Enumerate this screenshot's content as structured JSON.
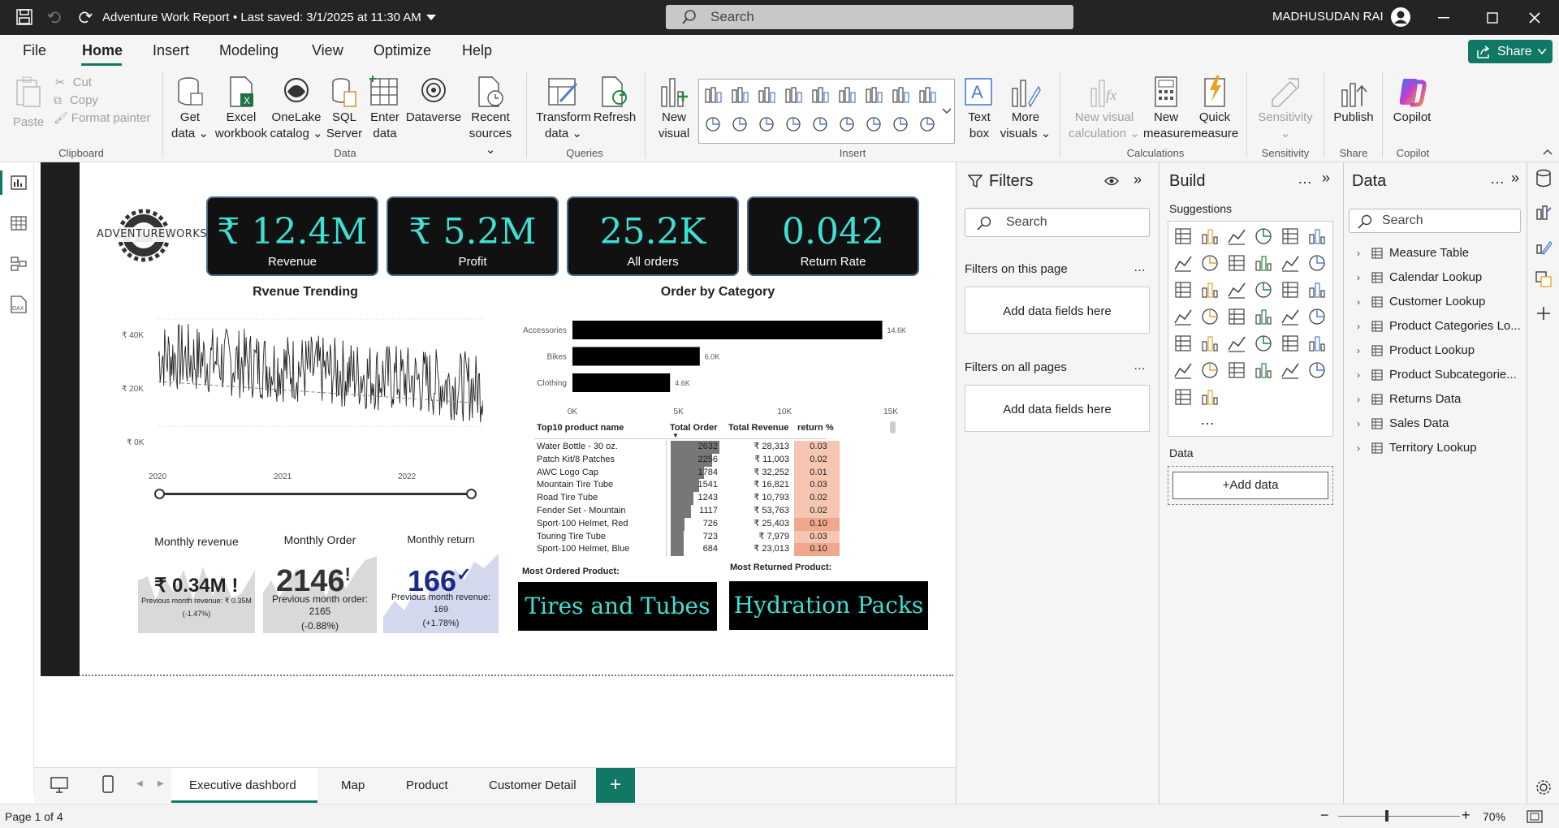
{
  "window": {
    "title": "Adventure Work Report",
    "saved": "• Last saved: 3/1/2025 at 11:30 AM",
    "search_placeholder": "Search",
    "user": "MADHUSUDAN RAI"
  },
  "menu": {
    "tabs": [
      "File",
      "Home",
      "Insert",
      "Modeling",
      "View",
      "Optimize",
      "Help"
    ],
    "active": "Home",
    "share": "Share"
  },
  "ribbon": {
    "clipboard": {
      "paste": "Paste",
      "cut": "Cut",
      "copy": "Copy",
      "format_painter": "Format painter",
      "group": "Clipboard"
    },
    "data": {
      "get_data": "Get",
      "get_data2": "data",
      "excel": "Excel",
      "excel2": "workbook",
      "onelake": "OneLake",
      "onelake2": "catalog",
      "sql": "SQL",
      "sql2": "Server",
      "enter": "Enter",
      "enter2": "data",
      "dataverse": "Dataverse",
      "recent": "Recent",
      "recent2": "sources",
      "group": "Data"
    },
    "queries": {
      "transform": "Transform",
      "transform2": "data",
      "refresh": "Refresh",
      "group": "Queries"
    },
    "insert": {
      "new_visual": "New",
      "new_visual2": "visual",
      "text_box": "Text",
      "text_box2": "box",
      "more_visuals": "More",
      "more_visuals2": "visuals",
      "group": "Insert"
    },
    "calculations": {
      "nvc": "New visual",
      "nvc2": "calculation",
      "new_measure": "New",
      "new_measure2": "measure",
      "quick_measure": "Quick",
      "quick_measure2": "measure",
      "group": "Calculations"
    },
    "sensitivity": {
      "label": "Sensitivity",
      "group": "Sensitivity"
    },
    "share": {
      "publish": "Publish",
      "group": "Share"
    },
    "copilot": {
      "label": "Copilot",
      "group": "Copilot"
    }
  },
  "kpis": [
    {
      "value": "₹ 12.4M",
      "label": "Revenue"
    },
    {
      "value": "₹ 5.2M",
      "label": "Profit"
    },
    {
      "value": "25.2K",
      "label": "All orders"
    },
    {
      "value": "0.042",
      "label": "Return Rate"
    }
  ],
  "logo": {
    "text": "ADVENTUREWORKS"
  },
  "trend": {
    "title": "Rvenue Trending",
    "yticks": [
      "₹ 40K",
      "₹ 20K",
      "₹ 0K"
    ],
    "xticks": [
      "2020",
      "2021",
      "2022"
    ]
  },
  "category": {
    "title": "Order by Category",
    "xticks": [
      "0K",
      "5K",
      "10K",
      "15K"
    ]
  },
  "chart_data": [
    {
      "type": "bar",
      "title": "Order by Category",
      "categories": [
        "Accessories",
        "Bikes",
        "Clothing"
      ],
      "values": [
        14.6,
        6.0,
        4.6
      ],
      "value_labels": [
        "14.6K",
        "6.0K",
        "4.6K"
      ],
      "xlim": [
        0,
        15
      ],
      "xlabel": "",
      "ylabel": ""
    },
    {
      "type": "line",
      "title": "Rvenue Trending",
      "x_range": [
        "2020",
        "2022"
      ],
      "ylim": [
        0,
        45000
      ],
      "approx_level": [
        28000,
        22000,
        15000
      ],
      "xlabel": "",
      "ylabel": ""
    }
  ],
  "table": {
    "headers": [
      "Top10 product name",
      "Total Order",
      "Total Revenue",
      "return %"
    ],
    "rows": [
      [
        "Water Bottle - 30 oz.",
        "2632",
        "₹ 28,313",
        "0.03"
      ],
      [
        "Patch Kit/8 Patches",
        "2256",
        "₹ 11,003",
        "0.02"
      ],
      [
        "AWC Logo Cap",
        "1784",
        "₹ 32,252",
        "0.01"
      ],
      [
        "Mountain Tire Tube",
        "1541",
        "₹ 16,821",
        "0.03"
      ],
      [
        "Road Tire Tube",
        "1243",
        "₹ 10,793",
        "0.02"
      ],
      [
        "Fender Set - Mountain",
        "1117",
        "₹ 53,763",
        "0.02"
      ],
      [
        "Sport-100 Helmet, Red",
        "726",
        "₹ 25,403",
        "0.10"
      ],
      [
        "Touring Tire Tube",
        "723",
        "₹ 7,979",
        "0.03"
      ],
      [
        "Sport-100 Helmet, Blue",
        "684",
        "₹ 23,013",
        "0.10"
      ]
    ]
  },
  "monthly": {
    "revenue": {
      "title": "Monthly revenue",
      "value": "₹ 0.34M",
      "mark": "!",
      "prev": "Previous month revenue: ₹ 0.35M",
      "change": "(-1.47%)"
    },
    "order": {
      "title": "Monthly Order",
      "value": "2146",
      "mark": "!",
      "prev": "Previous month order:",
      "prev2": "2165",
      "change": "(-0.88%)"
    },
    "return": {
      "title": "Monthly return",
      "value": "166",
      "mark": "✓",
      "prev": "Previous month revenue:",
      "prev2": "169",
      "change": "(+1.78%)"
    }
  },
  "most": {
    "ordered_label": "Most Ordered Product:",
    "ordered": "Tires and Tubes",
    "returned_label": "Most Returned Product:",
    "returned": "Hydration Packs"
  },
  "pages": {
    "tabs": [
      "Executive dashbord",
      "Map",
      "Product",
      "Customer Detail"
    ],
    "active": "Executive dashbord",
    "add": "+"
  },
  "status": {
    "page": "Page 1 of 4",
    "zoom": "70%"
  },
  "filters": {
    "title": "Filters",
    "search": "Search",
    "on_page": "Filters on this page",
    "on_all": "Filters on all pages",
    "add": "Add data fields here"
  },
  "build": {
    "title": "Build",
    "suggestions": "Suggestions",
    "data": "Data",
    "add_data": "+Add data"
  },
  "datapane": {
    "title": "Data",
    "search": "Search",
    "items": [
      "Measure Table",
      "Calendar Lookup",
      "Customer Lookup",
      "Product Categories Lo...",
      "Product Lookup",
      "Product Subcategorie...",
      "Returns Data",
      "Sales Data",
      "Territory Lookup"
    ]
  }
}
